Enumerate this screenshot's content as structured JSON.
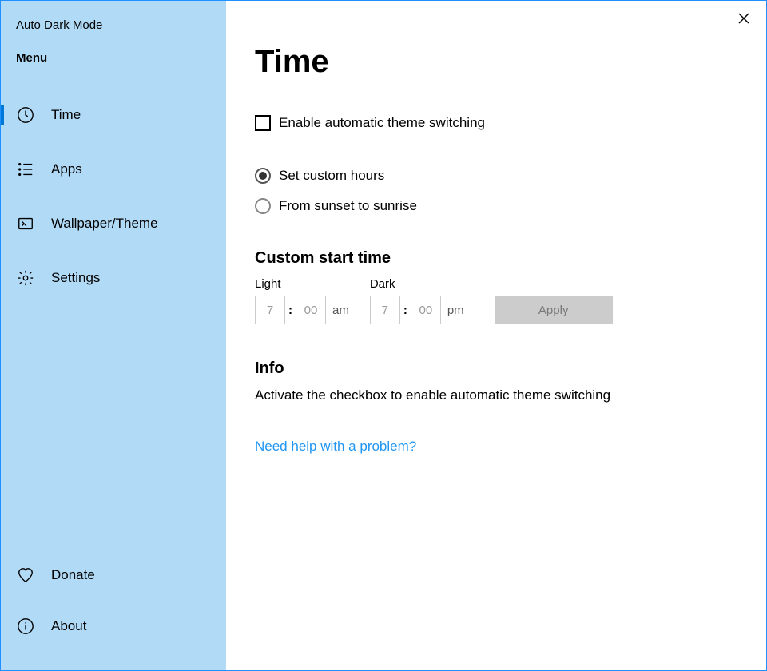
{
  "app_title": "Auto Dark Mode",
  "menu_title": "Menu",
  "sidebar": {
    "items": [
      {
        "label": "Time",
        "icon": "clock-icon",
        "selected": true
      },
      {
        "label": "Apps",
        "icon": "list-icon",
        "selected": false
      },
      {
        "label": "Wallpaper/Theme",
        "icon": "wallpaper-icon",
        "selected": false
      },
      {
        "label": "Settings",
        "icon": "gear-icon",
        "selected": false
      }
    ],
    "footer": [
      {
        "label": "Donate",
        "icon": "heart-icon"
      },
      {
        "label": "About",
        "icon": "info-icon"
      }
    ]
  },
  "main": {
    "title": "Time",
    "enable_checkbox": {
      "label": "Enable automatic theme switching",
      "checked": false
    },
    "schedule_options": [
      {
        "label": "Set custom hours",
        "selected": true
      },
      {
        "label": "From sunset to sunrise",
        "selected": false
      }
    ],
    "custom_start": {
      "title": "Custom start time",
      "light": {
        "label": "Light",
        "hour": "7",
        "minute": "00",
        "period": "am"
      },
      "dark": {
        "label": "Dark",
        "hour": "7",
        "minute": "00",
        "period": "pm"
      },
      "apply_label": "Apply"
    },
    "info": {
      "title": "Info",
      "text": "Activate the checkbox to enable automatic theme switching"
    },
    "help_link": "Need help with a problem?"
  }
}
